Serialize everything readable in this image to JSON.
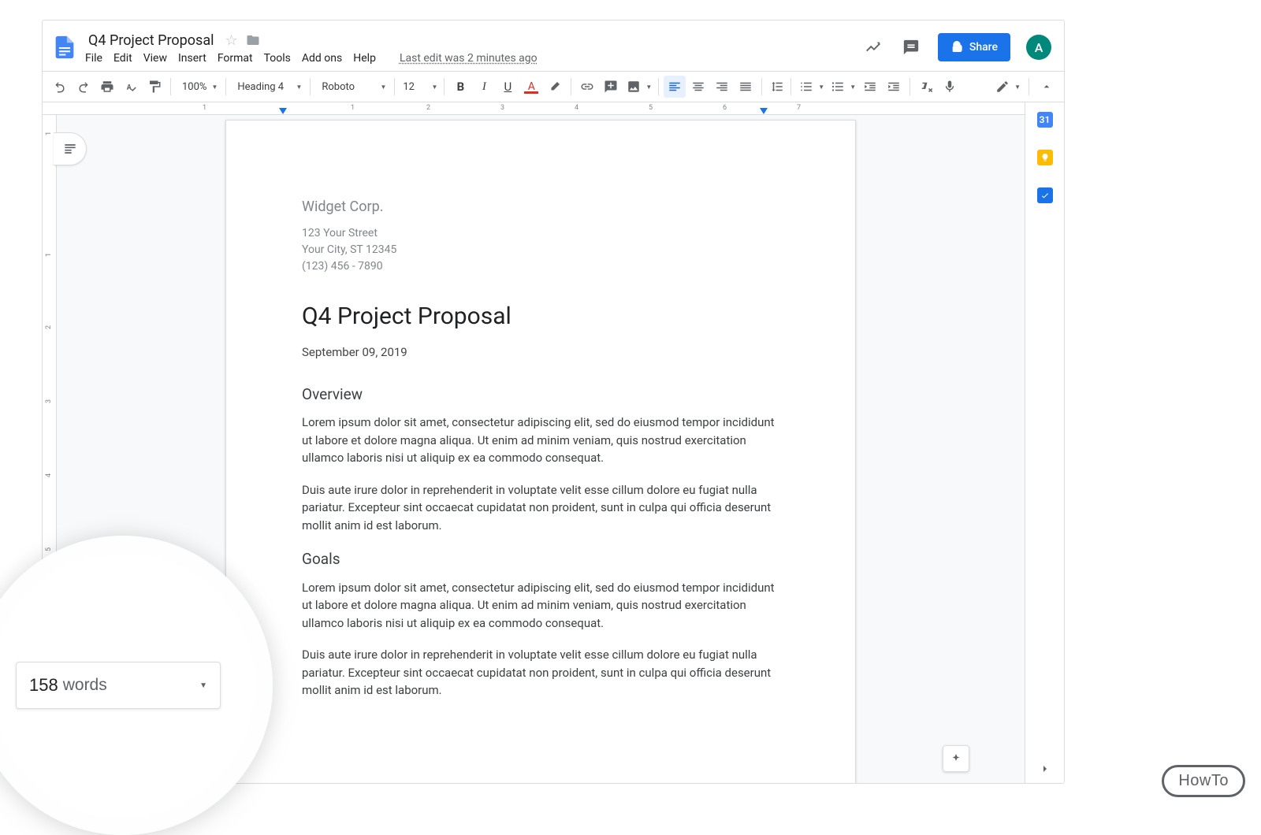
{
  "header": {
    "title": "Q4 Project Proposal",
    "lastEdit": "Last edit was 2 minutes ago",
    "share": "Share",
    "avatarInitial": "A"
  },
  "menus": [
    "File",
    "Edit",
    "View",
    "Insert",
    "Format",
    "Tools",
    "Add ons",
    "Help"
  ],
  "toolbar": {
    "zoom": "100%",
    "style": "Heading 4",
    "font": "Roboto",
    "fontSize": "12"
  },
  "sidepanel": {
    "calendarDay": "31"
  },
  "wordCount": {
    "count": "158",
    "label": "words"
  },
  "document": {
    "company": "Widget Corp.",
    "addr1": "123 Your Street",
    "addr2": "Your City, ST 12345",
    "addr3": "(123) 456 - 7890",
    "h1": "Q4 Project Proposal",
    "date": "September 09, 2019",
    "overviewTitle": "Overview",
    "overviewP1": "Lorem ipsum dolor sit amet, consectetur adipiscing elit, sed do eiusmod tempor incididunt ut labore et dolore magna aliqua. Ut enim ad minim veniam, quis nostrud exercitation ullamco laboris nisi ut aliquip ex ea commodo consequat.",
    "overviewP2": "Duis aute irure dolor in reprehenderit in voluptate velit esse cillum dolore eu fugiat nulla pariatur. Excepteur sint occaecat cupidatat non proident, sunt in culpa qui officia deserunt mollit anim id est laborum.",
    "goalsTitle": "Goals",
    "goalsP1": "Lorem ipsum dolor sit amet, consectetur adipiscing elit, sed do eiusmod tempor incididunt ut labore et dolore magna aliqua. Ut enim ad minim veniam, quis nostrud exercitation ullamco laboris nisi ut aliquip ex ea commodo consequat.",
    "goalsP2": "Duis aute irure dolor in reprehenderit in voluptate velit esse cillum dolore eu fugiat nulla pariatur. Excepteur sint occaecat cupidatat non proident, sunt in culpa qui officia deserunt mollit anim id est laborum."
  },
  "rulerH": [
    "1",
    "1",
    "2",
    "3",
    "4",
    "5",
    "6",
    "7"
  ],
  "howto": "HowTo"
}
